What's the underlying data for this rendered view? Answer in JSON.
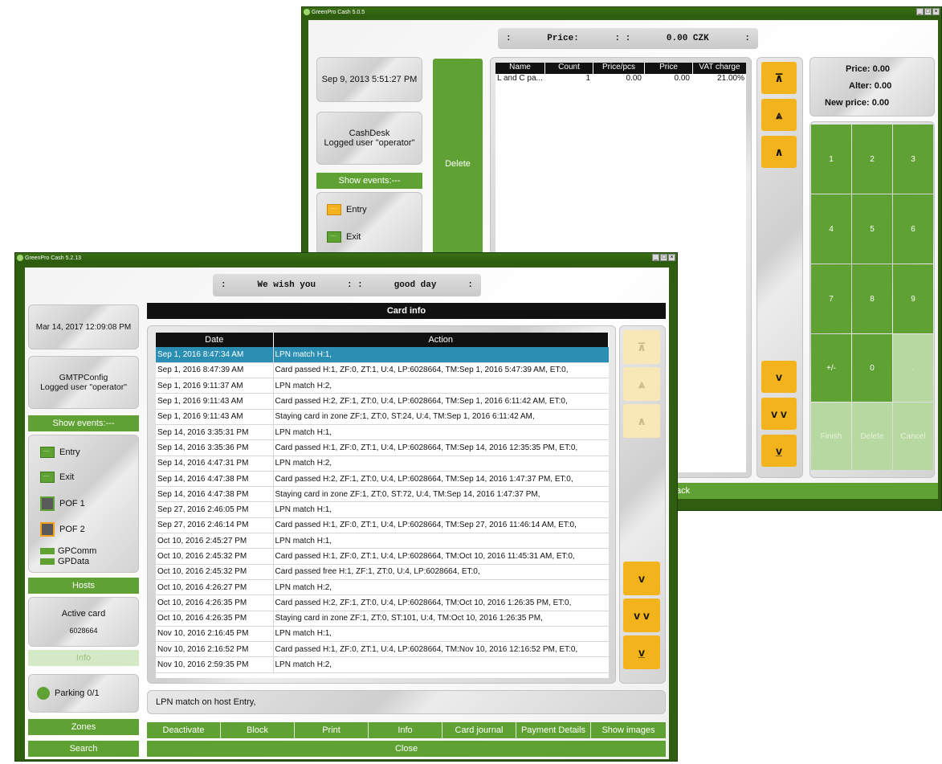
{
  "back_window": {
    "title": "GreenPro Cash 5.0.5",
    "marquee": [
      ":",
      "Price:",
      ": :",
      "0.00 CZK",
      ":"
    ],
    "datetime": "Sep 9, 2013 5:51:27 PM",
    "station": "CashDesk",
    "logged_user": "Logged user \"operator\"",
    "show_events": "Show events:---",
    "delete_label": "Delete",
    "events": [
      "Entry",
      "Exit"
    ],
    "table_headers": [
      "Name",
      "Count",
      "Price/pcs",
      "Price",
      "VAT charge"
    ],
    "table_rows": [
      [
        "L and C pa...",
        "1",
        "0.00",
        "0.00",
        "21.00%"
      ]
    ],
    "price_panel": {
      "price_label": "Price:",
      "price_value": "0.00",
      "alter_label": "Alter:",
      "alter_value": "0.00",
      "new_price_label": "New price:",
      "new_price_value": "0.00"
    },
    "keypad": [
      "1",
      "2",
      "3",
      "4",
      "5",
      "6",
      "7",
      "8",
      "9",
      "+/-",
      "0",
      "."
    ],
    "keypad_actions": [
      "Finish",
      "Delete",
      "Cancel"
    ],
    "scroll_up": [
      "⊼",
      "⩓",
      "∧"
    ],
    "scroll_down": [
      "v",
      "v v",
      "v̲"
    ],
    "bottom_partial": "ack"
  },
  "front_window": {
    "title": "GreenPro Cash 5.2.13",
    "marquee": [
      ":",
      "We wish you",
      ": :",
      "good day",
      ":"
    ],
    "datetime": "Mar 14, 2017 12:09:08 PM",
    "station": "GMTPConfig",
    "logged_user": "Logged user \"operator\"",
    "show_events": "Show events:---",
    "events": [
      {
        "label": "Entry",
        "kind": "green"
      },
      {
        "label": "Exit",
        "kind": "green"
      },
      {
        "label": "POF 1",
        "kind": "pof"
      },
      {
        "label": "POF 2",
        "kind": "pof-orange"
      }
    ],
    "services": [
      "GPComm",
      "GPData"
    ],
    "hosts_label": "Hosts",
    "active_card_label": "Active card",
    "active_card_value": "6028664",
    "info_label": "Info",
    "parking_label": "Parking 0/1",
    "zones_label": "Zones",
    "search_label": "Search",
    "panel_title": "Card info",
    "table_headers": [
      "Date",
      "Action"
    ],
    "rows": [
      [
        "Sep 1, 2016 8:47:34 AM",
        "LPN match H:1,"
      ],
      [
        "Sep 1, 2016 8:47:39 AM",
        "Card passed H:1, ZF:0, ZT:1, U:4, LP:6028664, TM:Sep 1, 2016 5:47:39 AM, ET:0,"
      ],
      [
        "Sep 1, 2016 9:11:37 AM",
        "LPN match H:2,"
      ],
      [
        "Sep 1, 2016 9:11:43 AM",
        "Card passed H:2, ZF:1, ZT:0, U:4, LP:6028664, TM:Sep 1, 2016 6:11:42 AM, ET:0,"
      ],
      [
        "Sep 1, 2016 9:11:43 AM",
        "Staying card in zone ZF:1, ZT:0, ST:24, U:4, TM:Sep 1, 2016 6:11:42 AM,"
      ],
      [
        "Sep 14, 2016 3:35:31 PM",
        "LPN match H:1,"
      ],
      [
        "Sep 14, 2016 3:35:36 PM",
        "Card passed H:1, ZF:0, ZT:1, U:4, LP:6028664, TM:Sep 14, 2016 12:35:35 PM, ET:0,"
      ],
      [
        "Sep 14, 2016 4:47:31 PM",
        "LPN match H:2,"
      ],
      [
        "Sep 14, 2016 4:47:38 PM",
        "Card passed H:2, ZF:1, ZT:0, U:4, LP:6028664, TM:Sep 14, 2016 1:47:37 PM, ET:0,"
      ],
      [
        "Sep 14, 2016 4:47:38 PM",
        "Staying card in zone ZF:1, ZT:0, ST:72, U:4, TM:Sep 14, 2016 1:47:37 PM,"
      ],
      [
        "Sep 27, 2016 2:46:05 PM",
        "LPN match H:1,"
      ],
      [
        "Sep 27, 2016 2:46:14 PM",
        "Card passed H:1, ZF:0, ZT:1, U:4, LP:6028664, TM:Sep 27, 2016 11:46:14 AM, ET:0,"
      ],
      [
        "Oct 10, 2016 2:45:27 PM",
        "LPN match H:1,"
      ],
      [
        "Oct 10, 2016 2:45:32 PM",
        "Card passed H:1, ZF:0, ZT:1, U:4, LP:6028664, TM:Oct 10, 2016 11:45:31 AM, ET:0,"
      ],
      [
        "Oct 10, 2016 2:45:32 PM",
        "Card passed free H:1, ZF:1, ZT:0, U:4, LP:6028664, ET:0,"
      ],
      [
        "Oct 10, 2016 4:26:27 PM",
        "LPN match H:2,"
      ],
      [
        "Oct 10, 2016 4:26:35 PM",
        "Card passed H:2, ZF:1, ZT:0, U:4, LP:6028664, TM:Oct 10, 2016 1:26:35 PM, ET:0,"
      ],
      [
        "Oct 10, 2016 4:26:35 PM",
        "Staying card in zone ZF:1, ZT:0, ST:101, U:4, TM:Oct 10, 2016 1:26:35 PM,"
      ],
      [
        "Nov 10, 2016 2:16:45 PM",
        "LPN match H:1,"
      ],
      [
        "Nov 10, 2016 2:16:52 PM",
        "Card passed H:1, ZF:0, ZT:1, U:4, LP:6028664, TM:Nov 10, 2016 12:16:52 PM, ET:0,"
      ],
      [
        "Nov 10, 2016 2:59:35 PM",
        "LPN match H:2,"
      ]
    ],
    "status_message": "LPN match on host Entry,",
    "action_buttons": [
      "Deactivate",
      "Block",
      "Print",
      "Info",
      "Card journal",
      "Payment Details",
      "Show images"
    ],
    "close_label": "Close",
    "colors": {
      "frame": "#2f5e10",
      "button_green": "#5fa132",
      "scroll_yellow": "#f2b31c",
      "selection": "#2b8fb4"
    }
  }
}
